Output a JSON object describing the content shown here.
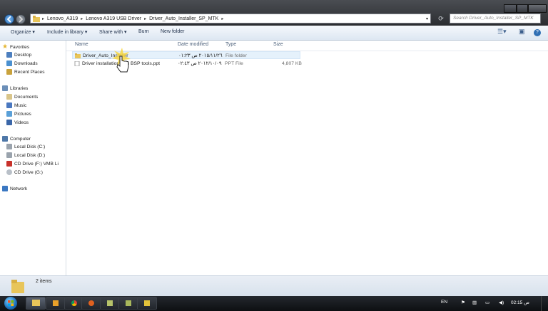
{
  "address": {
    "breadcrumbs": [
      "Lenovo_A319",
      "Lenovo A319 USB Driver",
      "Driver_Auto_Installer_SP_MTK"
    ]
  },
  "search": {
    "placeholder": "Search Driver_Auto_Installer_SP_MTK"
  },
  "toolbar": {
    "organize": "Organize ▾",
    "include": "Include in library ▾",
    "share": "Share with ▾",
    "burn": "Burn",
    "new_folder": "New folder"
  },
  "sidebar": {
    "favorites": {
      "label": "Favorites",
      "items": [
        "Desktop",
        "Downloads",
        "Recent Places"
      ]
    },
    "libraries": {
      "label": "Libraries",
      "items": [
        "Documents",
        "Music",
        "Pictures",
        "Videos"
      ]
    },
    "computer": {
      "label": "Computer",
      "items": [
        "Local Disk (C:)",
        "Local Disk (D:)",
        "CD Drive (F:) VMB Li",
        "CD Drive (G:)"
      ]
    },
    "network": {
      "label": "Network"
    }
  },
  "columns": {
    "name": "Name",
    "date": "Date modified",
    "type": "Type",
    "size": "Size"
  },
  "files": [
    {
      "name": "Driver_Auto_Installer",
      "date": "٢٠١٥/١١/٢٦ ص ٠١:٢٣",
      "type": "File folder",
      "size": ""
    },
    {
      "name": "Driver installation with BSP tools.ppt",
      "date": "٢٠١٢/١٠/٠٩ ص ٠٢:٤٣",
      "type": "PPT File",
      "size": "4,807 KB"
    }
  ],
  "status": {
    "count": "2 items"
  },
  "taskbar": {
    "lang": "EN",
    "time": "02:15 ص"
  },
  "colors": {
    "accent": "#2f6fb4",
    "selected_row": "#e5f1fb",
    "title_bar": "#2b2d31"
  }
}
